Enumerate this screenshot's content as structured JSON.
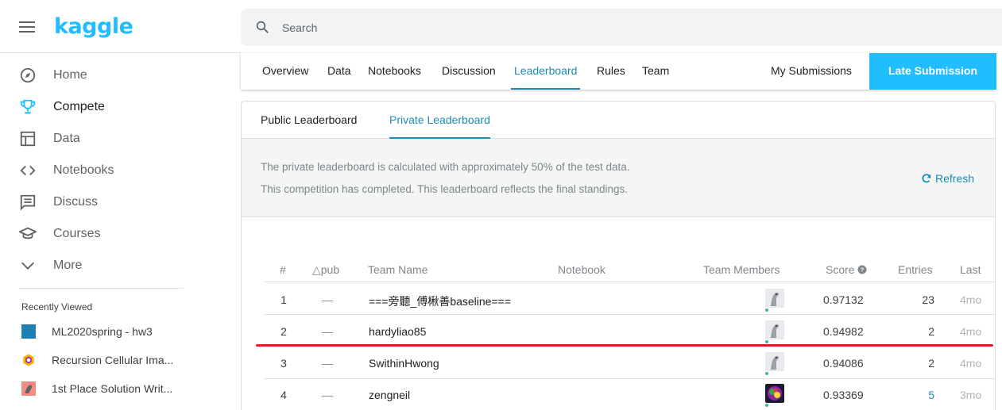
{
  "app": {
    "logo": "kaggle",
    "search_placeholder": "Search"
  },
  "sidebar": {
    "items": [
      {
        "label": "Home",
        "icon": "compass-icon"
      },
      {
        "label": "Compete",
        "icon": "trophy-icon",
        "active": true
      },
      {
        "label": "Data",
        "icon": "table-icon"
      },
      {
        "label": "Notebooks",
        "icon": "code-icon"
      },
      {
        "label": "Discuss",
        "icon": "comment-icon"
      },
      {
        "label": "Courses",
        "icon": "graduation-cap-icon"
      },
      {
        "label": "More",
        "icon": "chevron-down-icon"
      }
    ],
    "recent_title": "Recently Viewed",
    "recent": [
      {
        "label": "ML2020spring - hw3"
      },
      {
        "label": "Recursion Cellular Ima..."
      },
      {
        "label": "1st Place Solution Writ..."
      }
    ]
  },
  "comp_tabs": {
    "items": [
      "Overview",
      "Data",
      "Notebooks",
      "Discussion",
      "Leaderboard",
      "Rules",
      "Team"
    ],
    "active": "Leaderboard",
    "my_submissions": "My Submissions",
    "late_submission": "Late Submission"
  },
  "leaderboard": {
    "tabs": [
      "Public Leaderboard",
      "Private Leaderboard"
    ],
    "active_tab": "Private Leaderboard",
    "info_line1": "The private leaderboard is calculated with approximately 50% of the test data.",
    "info_line2": "This competition has completed. This leaderboard reflects the final standings.",
    "refresh": "Refresh",
    "columns": {
      "rank": "#",
      "delta": "△pub",
      "team": "Team Name",
      "notebook": "Notebook",
      "members": "Team Members",
      "score": "Score",
      "entries": "Entries",
      "last": "Last"
    },
    "rows": [
      {
        "rank": "1",
        "delta": "—",
        "team": "===旁聽_傅楸善baseline===",
        "score": "0.97132",
        "entries": "23",
        "last": "4mo"
      },
      {
        "rank": "2",
        "delta": "—",
        "team": "hardyliao85",
        "score": "0.94982",
        "entries": "2",
        "last": "4mo"
      },
      {
        "rank": "3",
        "delta": "—",
        "team": "SwithinHwong",
        "score": "0.94086",
        "entries": "2",
        "last": "4mo"
      },
      {
        "rank": "4",
        "delta": "—",
        "team": "zengneil",
        "score": "0.93369",
        "entries": "5",
        "last": "3mo"
      }
    ]
  },
  "colors": {
    "accent": "#20beff",
    "link": "#1a8ab8",
    "highlight_line": "#e11d2a"
  }
}
